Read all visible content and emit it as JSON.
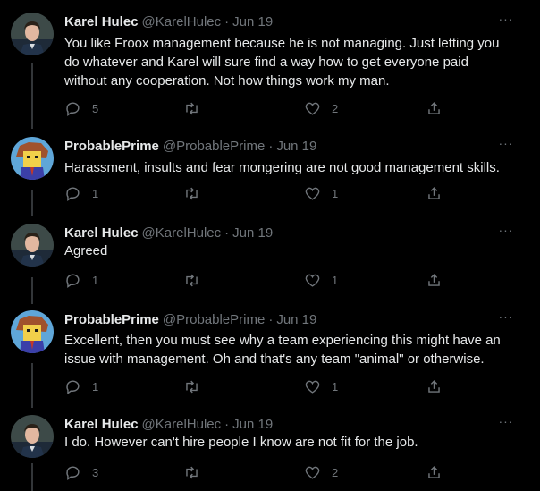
{
  "tweets": [
    {
      "avatar": "karel",
      "name": "Karel Hulec",
      "handle": "@KarelHulec",
      "dot": "·",
      "date": "Jun 19",
      "more": "···",
      "text": "You like Froox management because he is not managing. Just letting you do whatever and Karel will sure find a way how to get everyone paid without any cooperation. Not how things work my man.",
      "replies": "5",
      "retweets": "",
      "likes": "2"
    },
    {
      "avatar": "prime",
      "name": "ProbablePrime",
      "handle": "@ProbablePrime",
      "dot": "·",
      "date": "Jun 19",
      "more": "···",
      "text": "Harassment, insults and fear mongering are not good management skills.",
      "replies": "1",
      "retweets": "",
      "likes": "1"
    },
    {
      "avatar": "karel",
      "name": "Karel Hulec",
      "handle": "@KarelHulec",
      "dot": "·",
      "date": "Jun 19",
      "more": "···",
      "text": "Agreed",
      "replies": "1",
      "retweets": "",
      "likes": "1"
    },
    {
      "avatar": "prime",
      "name": "ProbablePrime",
      "handle": "@ProbablePrime",
      "dot": "·",
      "date": "Jun 19",
      "more": "···",
      "text": "Excellent, then you must see why a team experiencing this might have an issue with management. Oh and that's any team \"animal\" or otherwise.",
      "replies": "1",
      "retweets": "",
      "likes": "1"
    },
    {
      "avatar": "karel",
      "name": "Karel Hulec",
      "handle": "@KarelHulec",
      "dot": "·",
      "date": "Jun 19",
      "more": "···",
      "text": "I do. However can't hire people I know are not fit for the job.",
      "replies": "3",
      "retweets": "",
      "likes": "2"
    }
  ],
  "icons": {
    "reply": "reply-icon",
    "retweet": "retweet-icon",
    "like": "heart-icon",
    "share": "share-icon",
    "more": "more-options-icon"
  },
  "colors": {
    "background": "#000000",
    "text": "#e7e9ea",
    "muted": "#71767b",
    "thread_line": "#333639"
  }
}
